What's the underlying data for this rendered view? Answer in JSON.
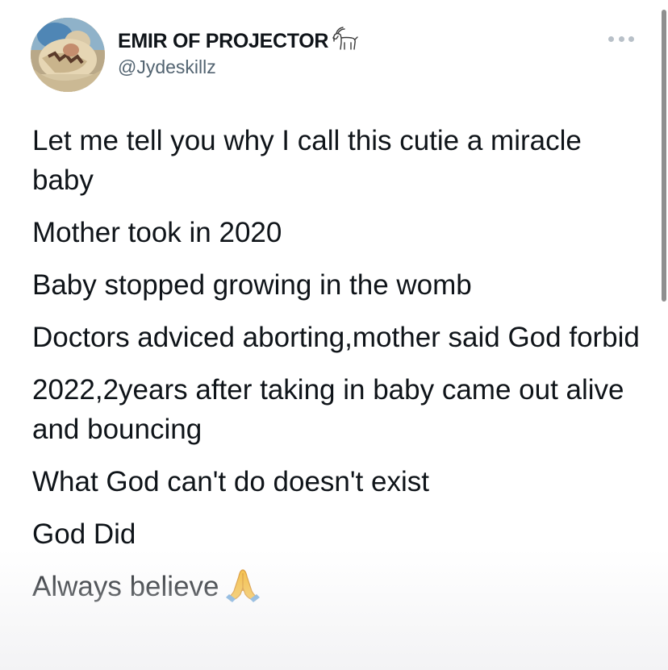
{
  "tweet": {
    "author": {
      "display_name": "EMIR OF PROJECTOR",
      "handle": "@Jydeskillz",
      "name_emoji_icon": "goat-icon",
      "avatar": "baby-photo"
    },
    "paragraphs": [
      "Let me tell you why I call this cutie a miracle baby",
      "Mother took in 2020",
      "Baby stopped growing in the womb",
      "Doctors adviced aborting,mother said God forbid",
      "2022,2years after taking in baby came out alive and bouncing",
      "What God can't do doesn't exist",
      "God Did",
      "Always believe"
    ],
    "last_paragraph_emoji_icon": "folded-hands-icon",
    "more_icon": "more-options-icon"
  },
  "colors": {
    "text": "#0f1419",
    "handle": "#536471",
    "more_dots": "#b8c0c8",
    "scrollbar": "#8f8f8f"
  }
}
